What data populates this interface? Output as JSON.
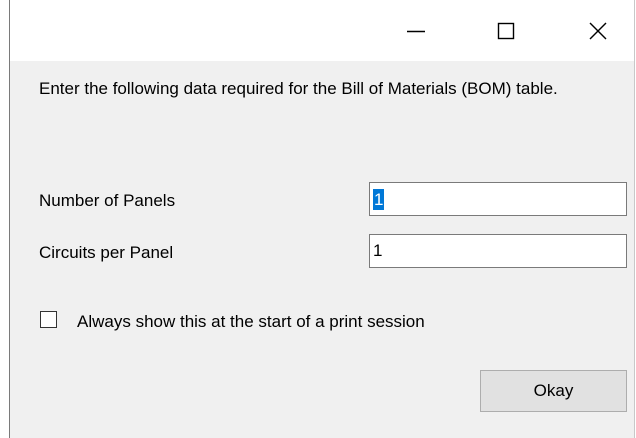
{
  "dialog": {
    "intro_text": "Enter the following data required for the Bill of Materials (BOM) table.",
    "fields": {
      "panels": {
        "label": "Number of Panels",
        "value": "1"
      },
      "circuits": {
        "label": "Circuits per Panel",
        "value": "1"
      }
    },
    "always_show": {
      "label": "Always show this at the start of a print session",
      "checked": false
    },
    "okay_label": "Okay"
  },
  "icons": {
    "minimize": "minimize-icon",
    "maximize": "maximize-icon",
    "close": "close-icon"
  },
  "colors": {
    "selection": "#0078d7",
    "client_background": "#f0f0f0"
  }
}
